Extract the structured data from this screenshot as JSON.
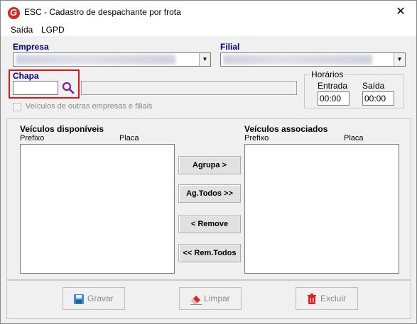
{
  "window": {
    "title": "ESC - Cadastro de despachante por frota",
    "close_glyph": "✕"
  },
  "menu": {
    "items": [
      "Saída",
      "LGPD"
    ]
  },
  "form": {
    "empresa_label": "Empresa",
    "filial_label": "Filial",
    "chapa_label": "Chapa",
    "chapa_value": "",
    "checkbox_label": "Veículos de outras empresas e filiais",
    "horarios": {
      "title": "Horários",
      "entrada_label": "Entrada",
      "entrada_value": "00:00",
      "saida_label": "Saída",
      "saida_value": "00:00"
    }
  },
  "lists": {
    "disponiveis": {
      "title": "Veículos disponíveis",
      "col_prefixo": "Prefixo",
      "col_placa": "Placa"
    },
    "associados": {
      "title": "Veículos associados",
      "col_prefixo": "Prefixo",
      "col_placa": "Placa"
    }
  },
  "actions": {
    "agrupa": "Agrupa >",
    "ag_todos": "Ag.Todos >>",
    "remove": "< Remove",
    "rem_todos": "<< Rem.Todos"
  },
  "footer": {
    "gravar": "Gravar",
    "limpar": "Limpar",
    "excluir": "Excluir"
  },
  "colors": {
    "title_label": "#000080",
    "highlight_border": "#e0161c",
    "search_icon": "#7b1fa2"
  }
}
